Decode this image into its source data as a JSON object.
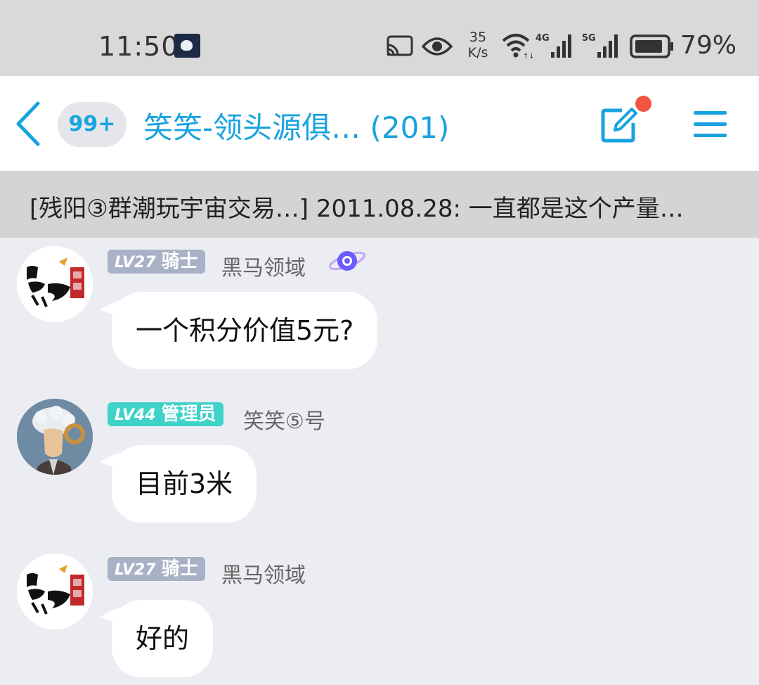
{
  "status_bar": {
    "time": "11:50",
    "speed_value": "35",
    "speed_unit": "K/s",
    "battery": "79%",
    "icons": [
      "app-icon",
      "cast-icon",
      "eye-icon",
      "wifi-icon",
      "4g-signal-icon",
      "5g-signal-icon",
      "battery-icon"
    ]
  },
  "header": {
    "unread_badge": "99+",
    "title": "笑笑-领头源俱…  (201)",
    "accent_color": "#18a2e0",
    "notify_color": "#f25643"
  },
  "pinned": {
    "text": "[残阳③群潮玩宇宙交易…] 2011.08.28: 一直都是这个产量…"
  },
  "messages": [
    {
      "level": "LV27",
      "title": "骑士",
      "sender": "黑马领域",
      "text": "一个积分价值5元?",
      "has_planet_icon": true
    },
    {
      "level": "LV44",
      "title": "管理员",
      "sender": "笑笑⑤号",
      "text": "目前3米"
    },
    {
      "level": "LV27",
      "title": "骑士",
      "sender": "黑马领域",
      "text": "好的"
    }
  ]
}
